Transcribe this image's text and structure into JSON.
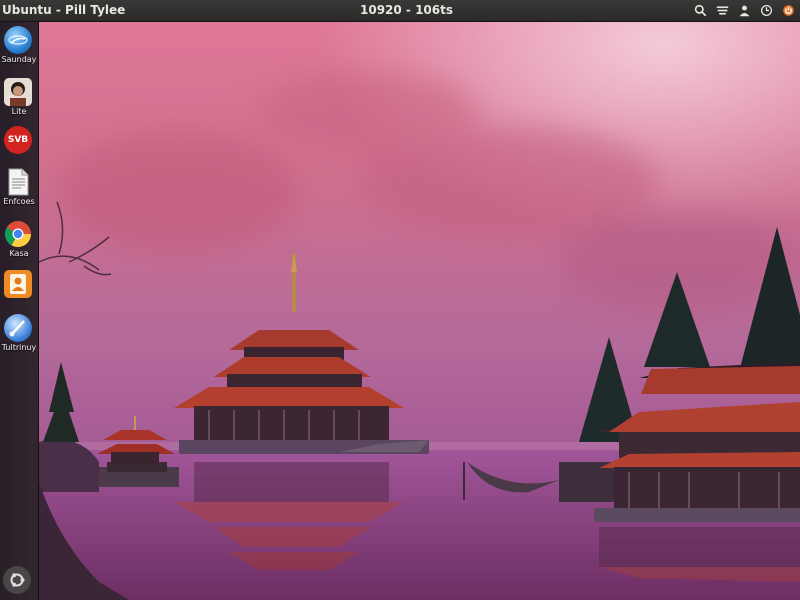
{
  "top_panel": {
    "app_title": "Ubuntu - Pill Tylee",
    "clock": "10920 - 106ts",
    "indicators": [
      "search-icon",
      "network-icon",
      "user-icon",
      "clock-icon",
      "power-icon"
    ]
  },
  "launcher": {
    "items": [
      {
        "icon": "globe-app-icon",
        "label": "Saunday",
        "color": "#2a7fd0"
      },
      {
        "icon": "person-photo-icon",
        "label": "Lite",
        "color": "#8a6a5a"
      },
      {
        "icon": "red-app-icon",
        "label": "",
        "badge_text": "SVB",
        "color": "#d3231e"
      },
      {
        "icon": "document-icon",
        "label": "Enfcoes",
        "color": "#eeeeee"
      },
      {
        "icon": "chrome-icon",
        "label": "Kasa",
        "color": "#dd4b39"
      },
      {
        "icon": "contacts-icon",
        "label": "",
        "color": "#f08a24"
      },
      {
        "icon": "paint-brush-icon",
        "label": "Tultrinuy",
        "color": "#3a7fd8"
      }
    ],
    "dash_icon": "ubuntu-logo-icon"
  },
  "wallpaper": {
    "subject": "pagoda-lake-scene",
    "sky_color": "#c8708e",
    "water_color": "#8a3f78"
  }
}
